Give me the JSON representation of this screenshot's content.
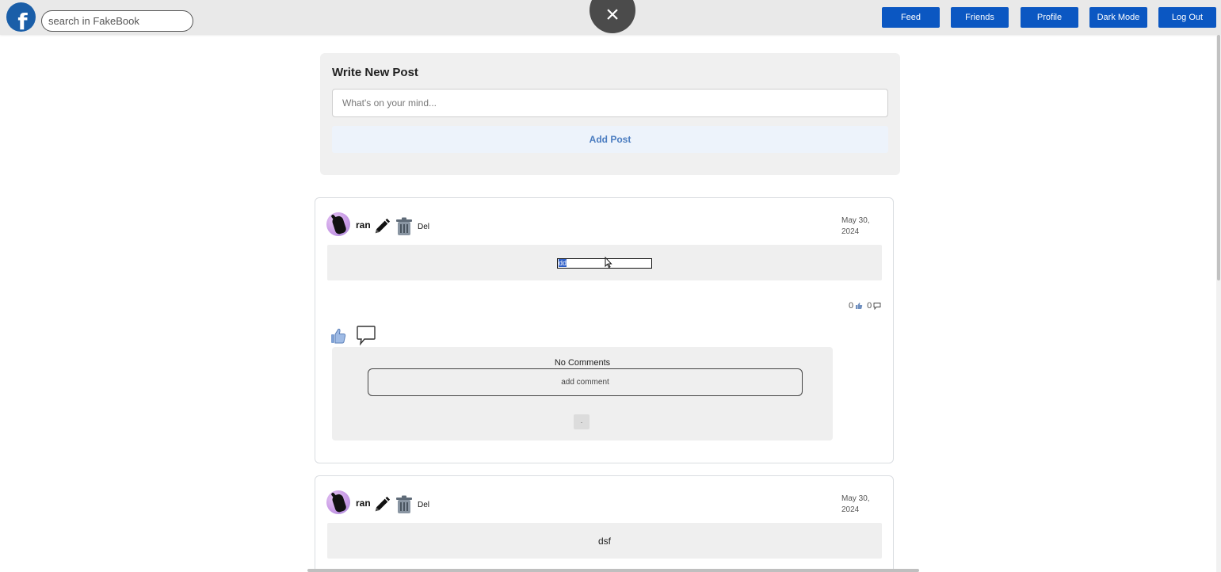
{
  "header": {
    "logo_letter": "f",
    "search_placeholder": "search in FakeBook",
    "close_glyph": "×",
    "nav": [
      "Feed",
      "Friends",
      "Profile",
      "Dark Mode",
      "Log Out"
    ],
    "nav_color": "#0b57c2"
  },
  "composer": {
    "title": "Write New Post",
    "placeholder": "What's on your mind...",
    "button": "Add Post"
  },
  "posts": [
    {
      "author": "ran",
      "delete_label": "Del",
      "date": "May 30, 2024",
      "edit_value": "dd",
      "likes": "0",
      "comments": "0",
      "no_comments": "No Comments",
      "comment_placeholder": "add comment",
      "comment_submit": "·"
    },
    {
      "author": "ran",
      "delete_label": "Del",
      "date": "May 30, 2024",
      "content": "dsf"
    }
  ]
}
